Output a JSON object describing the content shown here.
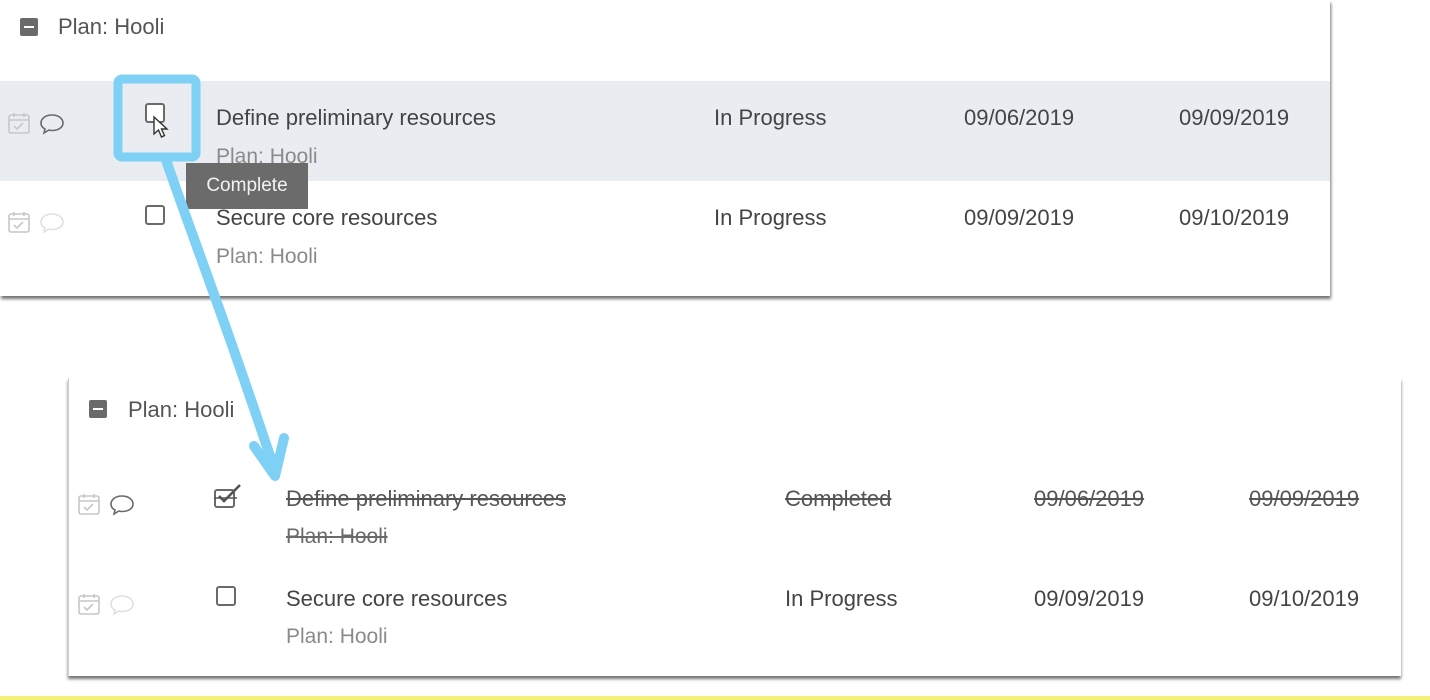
{
  "before": {
    "group_title": "Plan: Hooli",
    "tasks": [
      {
        "title": "Define preliminary resources",
        "plan": "Plan: Hooli",
        "status": "In Progress",
        "start": "09/06/2019",
        "due": "09/09/2019",
        "checked": false,
        "hovered": true
      },
      {
        "title": "Secure core resources",
        "plan": "Plan: Hooli",
        "status": "In Progress",
        "start": "09/09/2019",
        "due": "09/10/2019",
        "checked": false,
        "hovered": false
      }
    ],
    "tooltip": "Complete"
  },
  "after": {
    "group_title": "Plan: Hooli",
    "tasks": [
      {
        "title": "Define preliminary resources",
        "plan": "Plan: Hooli",
        "status": "Completed",
        "start": "09/06/2019",
        "due": "09/09/2019",
        "checked": true
      },
      {
        "title": "Secure core resources",
        "plan": "Plan: Hooli",
        "status": "In Progress",
        "start": "09/09/2019",
        "due": "09/10/2019",
        "checked": false
      }
    ]
  },
  "icons": {
    "collapse": "minus-square-icon",
    "calendar": "calendar-check-icon",
    "comment": "speech-bubble-icon",
    "cursor": "mouse-pointer-icon",
    "checkbox_checked": "checked-checkbox-icon"
  },
  "colors": {
    "annotation": "#7fd0f5",
    "row_highlight": "#e9edf1",
    "tooltip_bg": "#6b6b6b",
    "bottom_strip": "#f5f27a"
  }
}
